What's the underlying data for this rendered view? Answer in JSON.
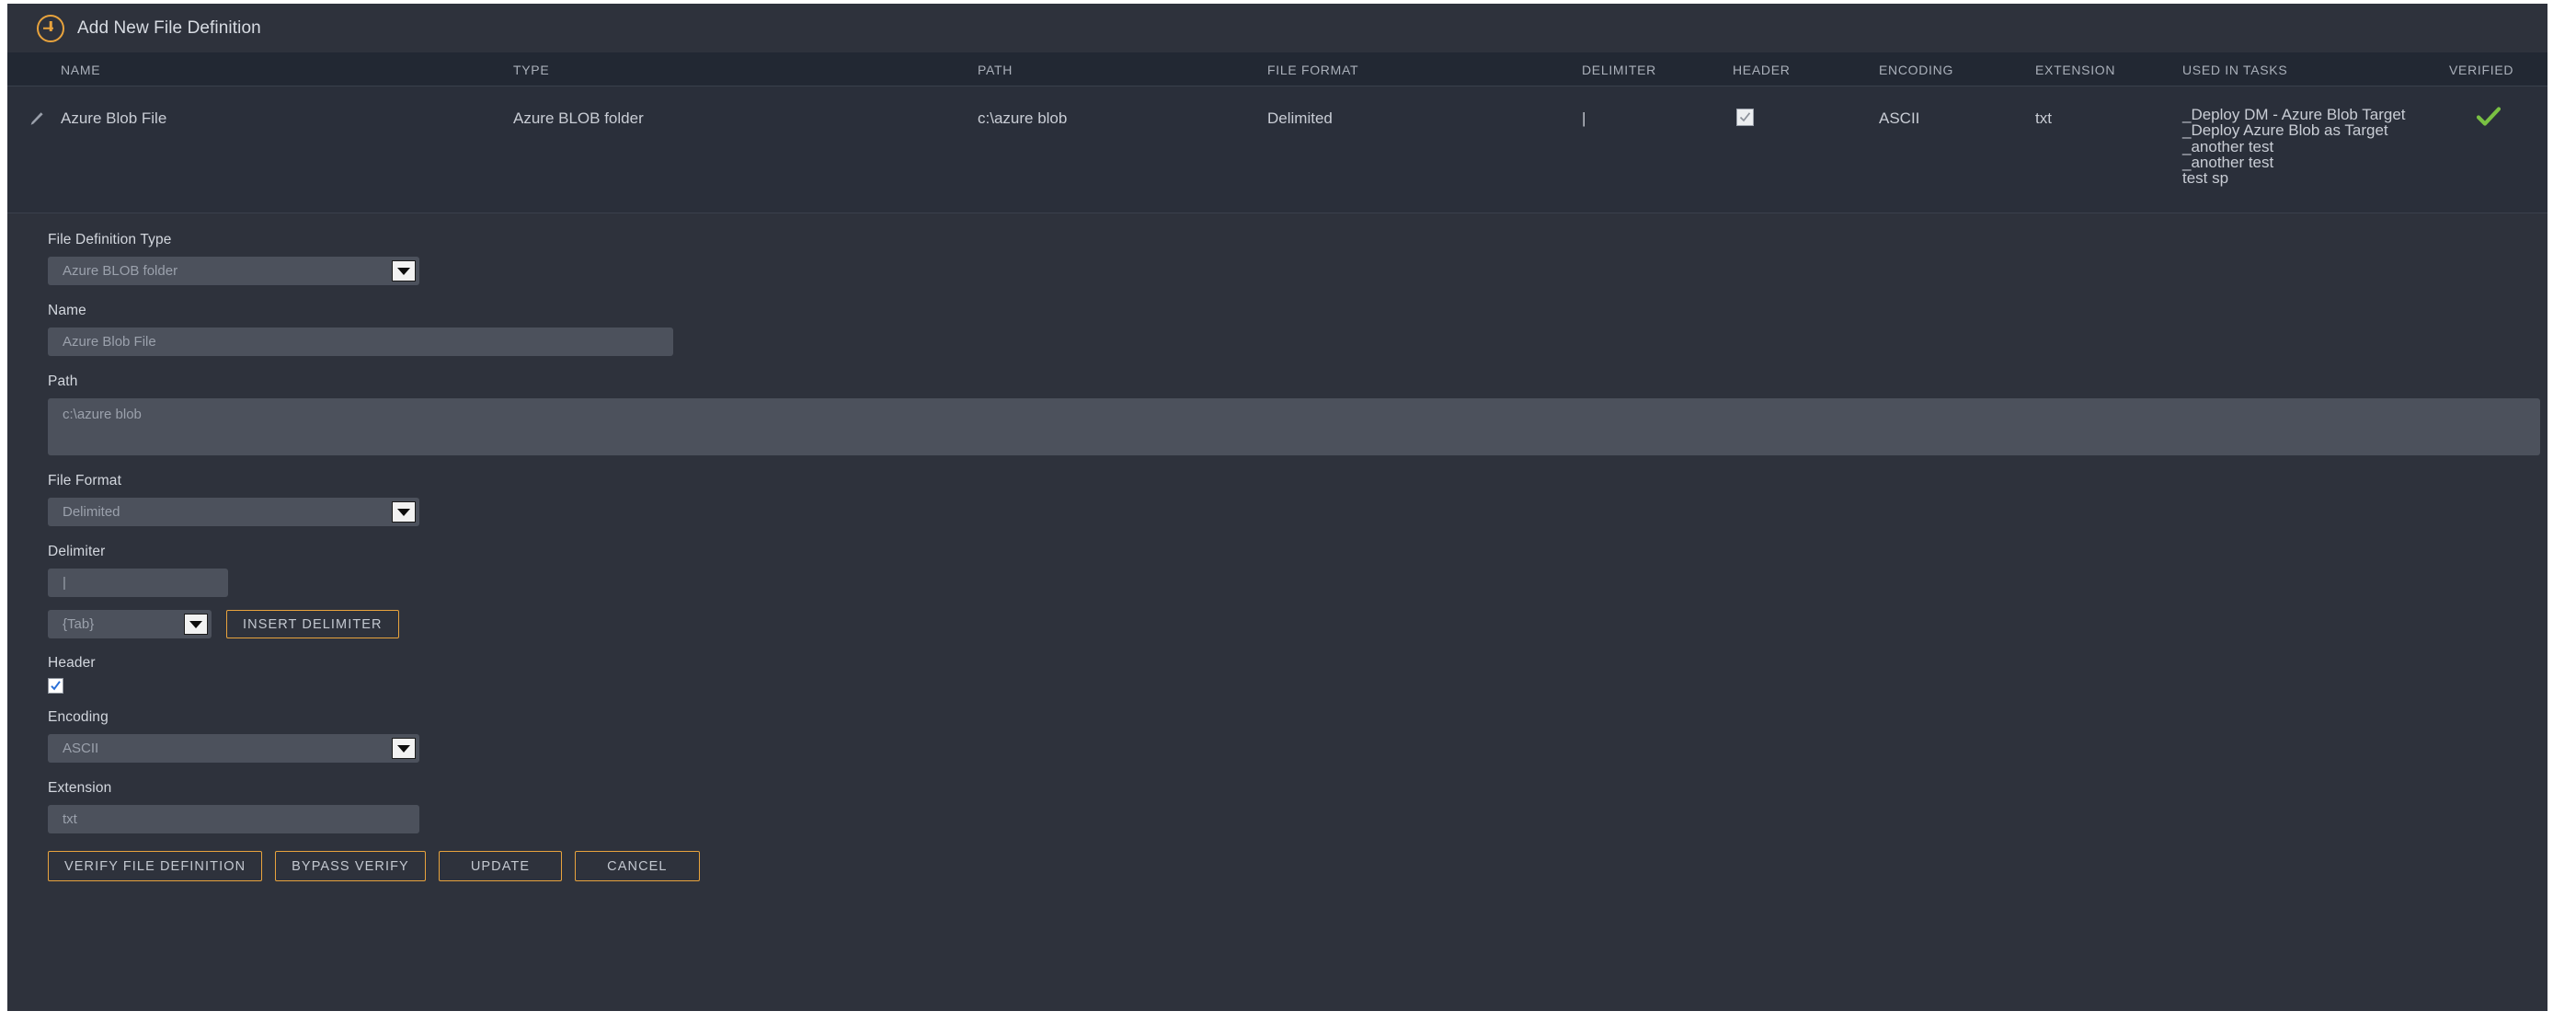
{
  "toolbar": {
    "add_label": "Add New File Definition",
    "add_icon": "plus-circle-icon",
    "accent_color": "#e8a33d"
  },
  "table": {
    "columns": [
      "NAME",
      "TYPE",
      "PATH",
      "FILE FORMAT",
      "DELIMITER",
      "HEADER",
      "ENCODING",
      "EXTENSION",
      "USED IN TASKS",
      "VERIFIED"
    ],
    "rows": [
      {
        "edit_icon": "pencil-icon",
        "name": "Azure Blob File",
        "type": "Azure BLOB folder",
        "path": "c:\\azure blob",
        "file_format": "Delimited",
        "delimiter": "|",
        "header": true,
        "encoding": "ASCII",
        "extension": "txt",
        "used_in_tasks": [
          "_Deploy DM - Azure Blob Target",
          "_Deploy Azure Blob as Target",
          "_another test",
          "_another test",
          "test sp"
        ],
        "verified": true,
        "verified_color": "#7ac143"
      }
    ]
  },
  "form": {
    "file_definition_type": {
      "label": "File Definition Type",
      "value": "Azure BLOB folder"
    },
    "name": {
      "label": "Name",
      "value": "Azure Blob File"
    },
    "path": {
      "label": "Path",
      "value": "c:\\azure blob"
    },
    "file_format": {
      "label": "File Format",
      "value": "Delimited"
    },
    "delimiter": {
      "label": "Delimiter",
      "value": "|"
    },
    "delimiter_preset": {
      "value": "{Tab}"
    },
    "insert_delimiter_label": "INSERT DELIMITER",
    "header": {
      "label": "Header",
      "checked": true
    },
    "encoding": {
      "label": "Encoding",
      "value": "ASCII"
    },
    "extension": {
      "label": "Extension",
      "value": "txt"
    }
  },
  "actions": {
    "verify": "VERIFY FILE DEFINITION",
    "bypass": "BYPASS VERIFY",
    "update": "UPDATE",
    "cancel": "CANCEL"
  }
}
